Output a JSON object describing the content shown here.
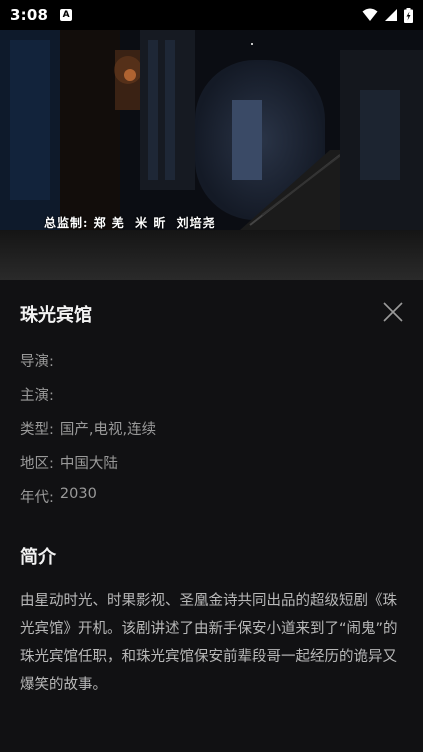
{
  "status_bar": {
    "time": "3:08",
    "app_icon_letter": "A",
    "icons": [
      "wifi-icon",
      "signal-icon",
      "battery-icon"
    ]
  },
  "video": {
    "credit": "总监制: 郑 羌  米 昕  刘培尧"
  },
  "detail": {
    "title": "珠光宾馆",
    "info": [
      {
        "label": "导演:",
        "value": ""
      },
      {
        "label": "主演:",
        "value": ""
      },
      {
        "label": "类型:",
        "value": "国产,电视,连续"
      },
      {
        "label": "地区:",
        "value": "中国大陆"
      },
      {
        "label": "年代:",
        "value": "2030"
      }
    ],
    "synopsis_heading": "简介",
    "synopsis": "由星动时光、时果影视、圣凰金诗共同出品的超级短剧《珠光宾馆》开机。该剧讲述了由新手保安小道来到了“闹鬼”的珠光宾馆任职，和珠光宾馆保安前辈段哥一起经历的诡异又爆笑的故事。"
  },
  "colors": {
    "background": "#111113",
    "title": "#f2f2f2",
    "info_text": "#9a9a9a",
    "synopsis_text": "#b8b8b8"
  }
}
